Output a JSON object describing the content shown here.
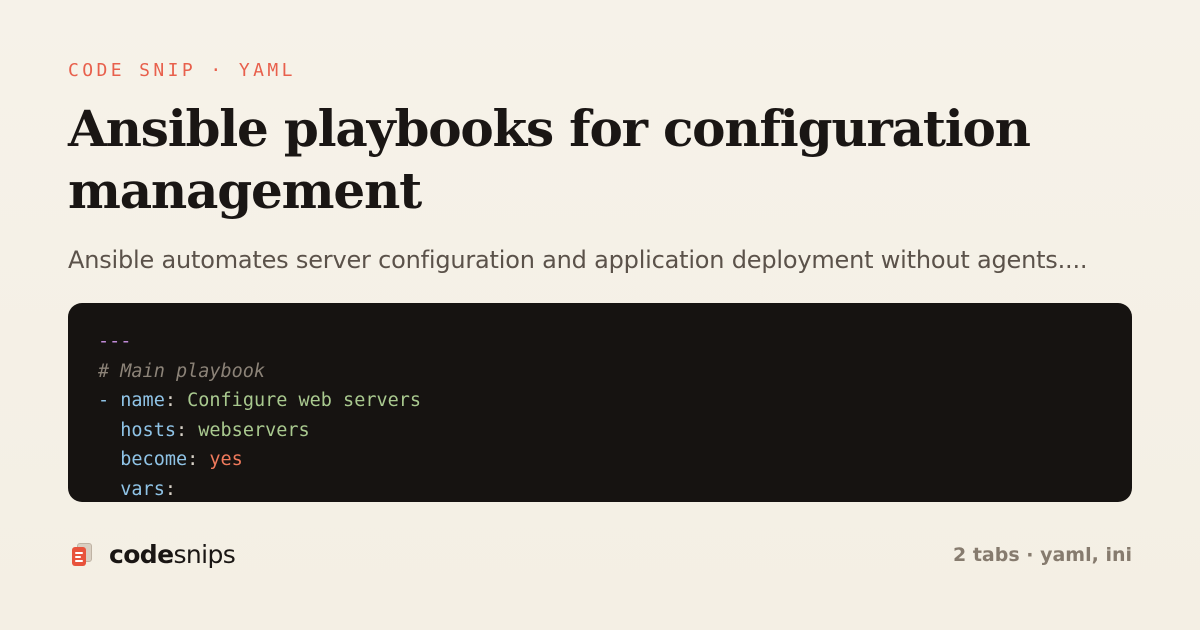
{
  "eyebrow": {
    "label": "CODE SNIP",
    "separator": "·",
    "language": "YAML"
  },
  "title": "Ansible playbooks for configuration management",
  "subtitle": "Ansible automates server configuration and application deployment without agents....",
  "code": {
    "lines": [
      [
        {
          "t": "---",
          "c": "sep"
        }
      ],
      [
        {
          "t": "# Main playbook",
          "c": "comment"
        }
      ],
      [
        {
          "t": "- ",
          "c": "dash"
        },
        {
          "t": "name",
          "c": "key"
        },
        {
          "t": ": ",
          "c": "punct"
        },
        {
          "t": "Configure web servers",
          "c": "str"
        }
      ],
      [
        {
          "t": "  ",
          "c": "punct"
        },
        {
          "t": "hosts",
          "c": "key"
        },
        {
          "t": ": ",
          "c": "punct"
        },
        {
          "t": "webservers",
          "c": "str"
        }
      ],
      [
        {
          "t": "  ",
          "c": "punct"
        },
        {
          "t": "become",
          "c": "key"
        },
        {
          "t": ": ",
          "c": "punct"
        },
        {
          "t": "yes",
          "c": "bool"
        }
      ],
      [
        {
          "t": "  ",
          "c": "punct"
        },
        {
          "t": "vars",
          "c": "key"
        },
        {
          "t": ":",
          "c": "punct"
        }
      ]
    ]
  },
  "brand": {
    "strong": "code",
    "light": "snips",
    "icon": "stacked-snippet-cards-icon"
  },
  "footer": {
    "meta": "2 tabs · yaml, ini"
  },
  "colors": {
    "background": "#f5f0e6",
    "accent": "#e8604c",
    "code_background": "#161311",
    "title": "#1a1614",
    "muted": "#867b6e"
  }
}
